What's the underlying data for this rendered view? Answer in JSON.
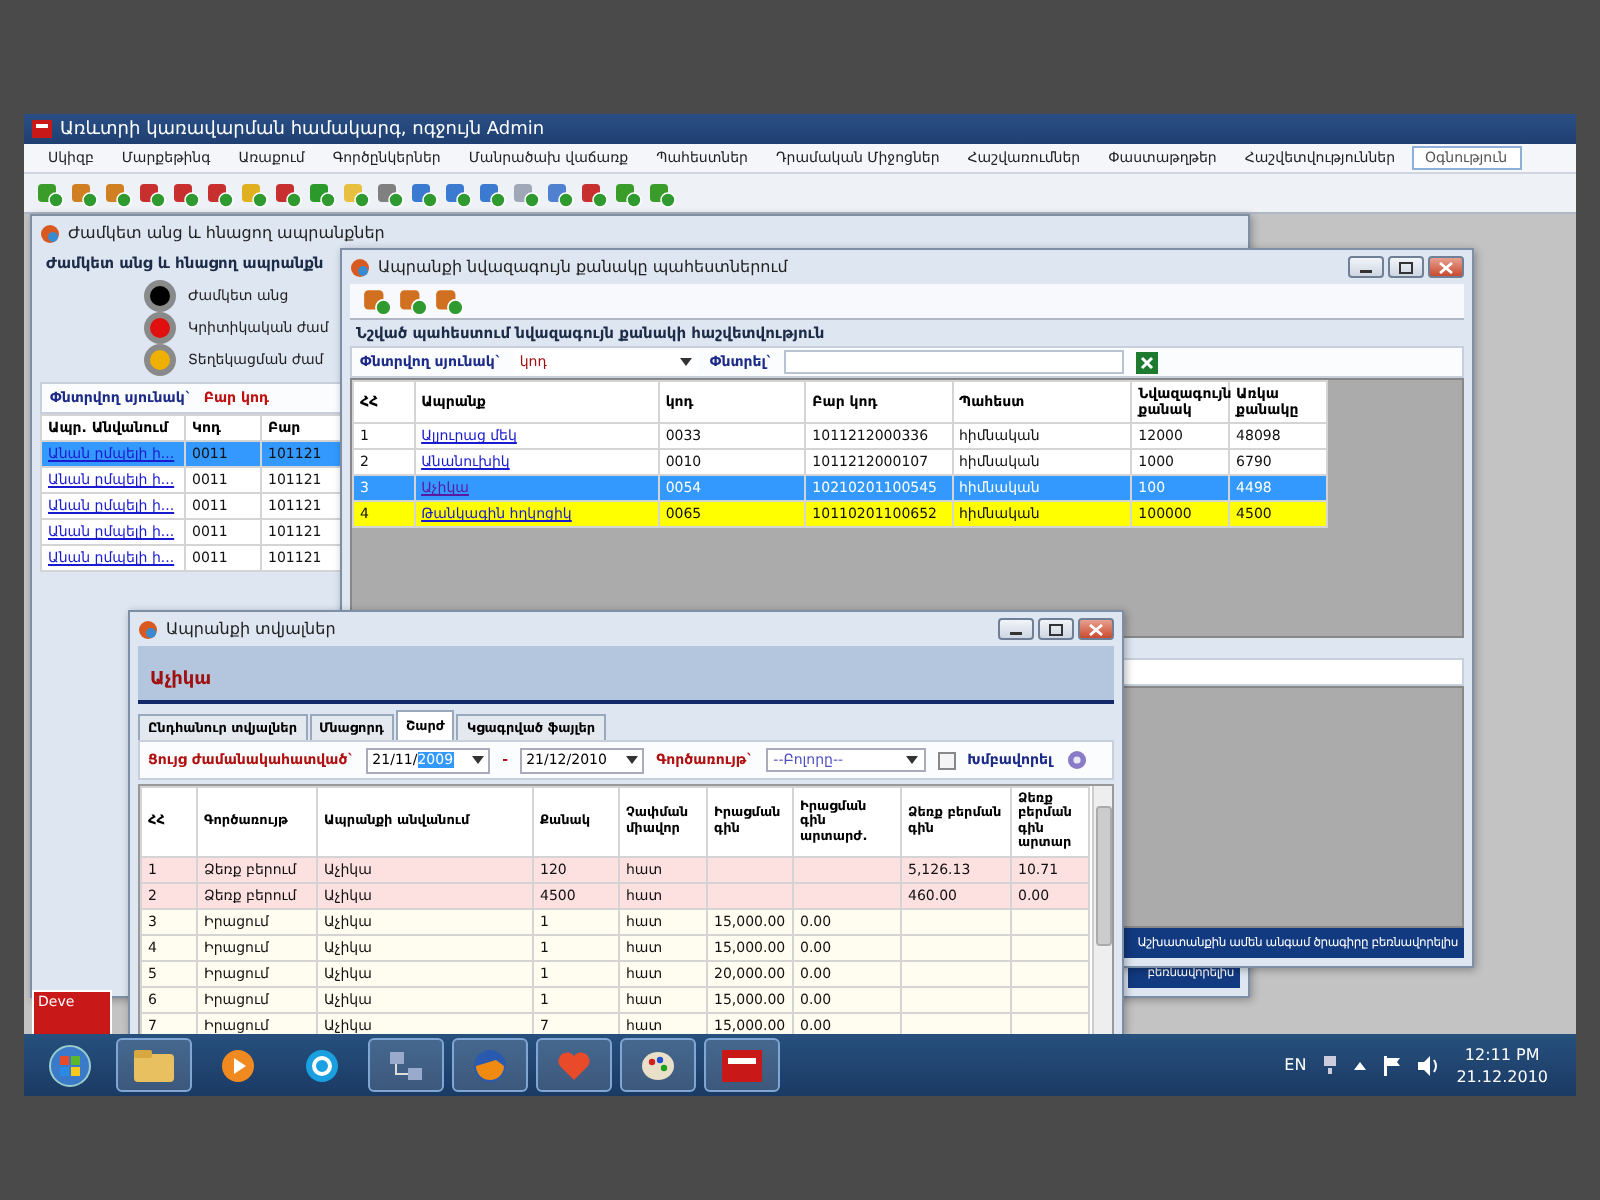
{
  "app": {
    "title": "Առևտրի կառավարման համակարգ, ոգջույն Admin",
    "menu": [
      {
        "label": "Սկիզբ",
        "selected": false
      },
      {
        "label": "Մարքեթինգ",
        "selected": false
      },
      {
        "label": "Առաքում",
        "selected": false
      },
      {
        "label": "Գործընկերներ",
        "selected": false
      },
      {
        "label": "Մանրածախ վաճառք",
        "selected": false
      },
      {
        "label": "Պահեստներ",
        "selected": false
      },
      {
        "label": "Դրամական Միջոցներ",
        "selected": false
      },
      {
        "label": "Հաշվառումներ",
        "selected": false
      },
      {
        "label": "Փաստաթղթեր",
        "selected": false
      },
      {
        "label": "Հաշվետվություններ",
        "selected": false
      },
      {
        "label": "Օգնություն",
        "selected": true
      }
    ]
  },
  "alert_window": {
    "title": "Ժամկետ անց և հնացող ապրանքներ",
    "header": "Ժամկետ անց և հնացող ապրանքն",
    "legend": [
      {
        "label": "Ժամկետ անց",
        "color": "#000000"
      },
      {
        "label": "Կրիտիկական ժամ",
        "color": "#e01010"
      },
      {
        "label": "Տեղեկացման ժամ",
        "color": "#f0b000"
      }
    ],
    "filter_label": "Փնտրվող սյունակ`",
    "filter_value": "Բար կոդ",
    "columns": [
      "Ապր. Անվանում",
      "Կոդ",
      "Բար"
    ],
    "rows": [
      {
        "cells": [
          "Անան ըմպելի ի...",
          "0011",
          "101121"
        ],
        "selected": true
      },
      {
        "cells": [
          "Անան ըմպելի ի...",
          "0011",
          "101121"
        ],
        "selected": false
      },
      {
        "cells": [
          "Անան ըմպելի ի...",
          "0011",
          "101121"
        ],
        "selected": false
      },
      {
        "cells": [
          "Անան ըմպելի ի...",
          "0011",
          "101121"
        ],
        "selected": false
      },
      {
        "cells": [
          "Անան ըմպելի ի...",
          "0011",
          "101121"
        ],
        "selected": false
      }
    ],
    "status": "բեռնավորելիս"
  },
  "min_stock_window": {
    "title": "Ապրանքի նվազագույն քանակը պահեստներում",
    "group": "Նշված պահեստում նվազագույն քանակի հաշվետվություն",
    "filter_label": "Փնտրվող սյունակ`",
    "filter_value": "կոդ",
    "search_label": "Փնտրել`",
    "columns": [
      "ՀՀ",
      "Ապրանք",
      "կոդ",
      "Բար կոդ",
      "Պահեստ",
      "Նվազագույն քանակ",
      "Առկա քանակը"
    ],
    "rows": [
      {
        "cells": [
          "1",
          "Ալյուրաց մեկ",
          "0033",
          "1011212000336",
          "հիմնական",
          "12000",
          "48098"
        ],
        "selected": false,
        "highlighted": false
      },
      {
        "cells": [
          "2",
          "Անանուխիկ",
          "0010",
          "1011212000107",
          "հիմնական",
          "1000",
          "6790"
        ],
        "selected": false,
        "highlighted": false
      },
      {
        "cells": [
          "3",
          "Աչիկա",
          "0054",
          "10210201100545",
          "հիմնական",
          "100",
          "4498"
        ],
        "selected": true,
        "highlighted": false
      },
      {
        "cells": [
          "4",
          "Թանկագին հղկոցիկ",
          "0065",
          "10110201100652",
          "հիմնական",
          "100000",
          "4500"
        ],
        "selected": false,
        "highlighted": true
      }
    ],
    "status": "Աշխատանքին ամեն անգամ ծրագիրը բեռնավորելիս"
  },
  "product_window": {
    "title": "Ապրանքի տվյալներ",
    "header": "Աչիկա",
    "tabs": [
      {
        "label": "Ընդհանուր տվյալներ",
        "selected": false
      },
      {
        "label": "Մնացորդ",
        "selected": false
      },
      {
        "label": "Շարժ",
        "selected": true
      },
      {
        "label": "Կցագրված ֆայլեր",
        "selected": false
      }
    ],
    "period_label": "Ցույց ժամանակահատված`",
    "date_from": "21/11/",
    "date_from_year": "2009",
    "year_selected": true,
    "dash": "-",
    "date_to": "21/12/2010",
    "operation_label": "Գործառույթ`",
    "operation_value": "--Բոլորը--",
    "group_checkbox": {
      "label": "Խմբավորել",
      "checked": false
    },
    "columns": [
      "ՀՀ",
      "Գործառույթ",
      "Ապրանքի անվանում",
      "Քանակ",
      "Չափման միավոր",
      "Իրացման գին",
      "Իրացման գին արտարժ.",
      "Ձեռք բերման գին",
      "Ձեռք բերման գին արտար"
    ],
    "rows": [
      {
        "kind": "purchase",
        "cells": [
          "1",
          "Ձեռք բերում",
          "Աչիկա",
          "120",
          "հատ",
          "",
          "",
          "5,126.13",
          "10.71"
        ]
      },
      {
        "kind": "purchase",
        "cells": [
          "2",
          "Ձեռք բերում",
          "Աչիկա",
          "4500",
          "հատ",
          "",
          "",
          "460.00",
          "0.00"
        ]
      },
      {
        "kind": "sale",
        "cells": [
          "3",
          "Իրացում",
          "Աչիկա",
          "1",
          "հատ",
          "15,000.00",
          "0.00",
          "",
          ""
        ]
      },
      {
        "kind": "sale",
        "cells": [
          "4",
          "Իրացում",
          "Աչիկա",
          "1",
          "հատ",
          "15,000.00",
          "0.00",
          "",
          ""
        ]
      },
      {
        "kind": "sale",
        "cells": [
          "5",
          "Իրացում",
          "Աչիկա",
          "1",
          "հատ",
          "20,000.00",
          "0.00",
          "",
          ""
        ]
      },
      {
        "kind": "sale",
        "cells": [
          "6",
          "Իրացում",
          "Աչիկա",
          "1",
          "հատ",
          "15,000.00",
          "0.00",
          "",
          ""
        ]
      },
      {
        "kind": "sale",
        "cells": [
          "7",
          "Իրացում",
          "Աչիկա",
          "7",
          "հատ",
          "15,000.00",
          "0.00",
          "",
          ""
        ]
      }
    ]
  },
  "desktop_logo": "Deve",
  "taskbar": {
    "language": "EN",
    "time": "12:11 PM",
    "date": "21.12.2010"
  }
}
